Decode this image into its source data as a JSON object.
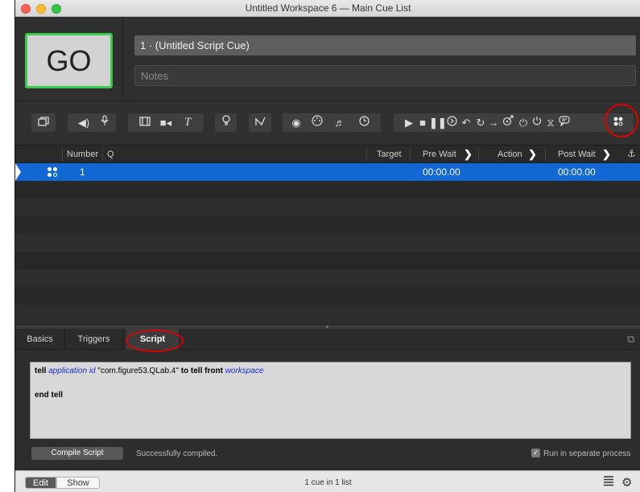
{
  "window": {
    "title": "Untitled Workspace 6 — Main Cue List"
  },
  "go_button": {
    "label": "GO"
  },
  "cue_name": "1 · (Untitled Script Cue)",
  "notes_placeholder": "Notes",
  "toolbar": {
    "icons": [
      "group-icon",
      "audio-icon",
      "mic-icon",
      "video-icon",
      "camera-icon",
      "text-icon",
      "light-icon",
      "fade-icon",
      "network-icon",
      "midi-icon",
      "midi-file-icon",
      "timecode-icon",
      "start-icon",
      "stop-icon",
      "pause-icon",
      "load-icon",
      "reset-icon",
      "devamp-icon",
      "goto-icon",
      "target-icon",
      "arm-icon",
      "disarm-icon",
      "wait-icon",
      "memo-icon",
      "script-icon"
    ]
  },
  "list": {
    "columns": [
      "Number",
      "Q",
      "Target",
      "Pre Wait",
      "Action",
      "Post Wait"
    ],
    "rows": [
      {
        "number": "1",
        "q": "",
        "target": "",
        "pre_wait": "00:00.00",
        "action": "",
        "post_wait": "00:00.00",
        "type_icon": "script-icon",
        "selected": true
      }
    ]
  },
  "tabs": [
    "Basics",
    "Triggers",
    "Script"
  ],
  "active_tab": "Script",
  "script": {
    "line1": {
      "tell": "tell",
      "application": "application",
      "id": "id",
      "bundle": "\"com.figure53.QLab.4\"",
      "to_tell_front": "to tell front",
      "workspace": "workspace"
    },
    "line2": "",
    "line3": "end tell"
  },
  "compile_button": "Compile Script",
  "compile_status": "Successfully compiled.",
  "run_separate": {
    "label": "Run in separate process",
    "checked": true,
    "check_glyph": "✓"
  },
  "bottombar": {
    "edit": "Edit",
    "show": "Show",
    "status": "1 cue in 1 list"
  },
  "colors": {
    "go_border": "#3bc94c",
    "selection": "#1167d3",
    "annotation": "#e00000"
  }
}
